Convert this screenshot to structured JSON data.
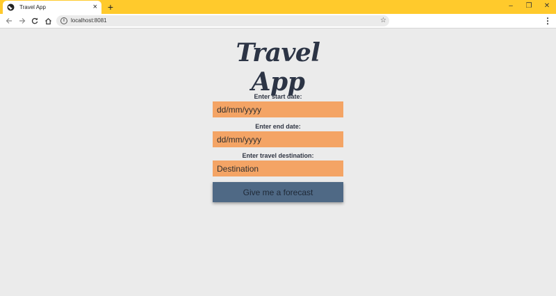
{
  "browser": {
    "tab_title": "Travel App",
    "tab_close": "×",
    "new_tab": "+",
    "url": "localhost:8081",
    "window_controls": {
      "minimize": "–",
      "restore": "❐",
      "close": "✕"
    }
  },
  "app": {
    "title": "Travel App",
    "form": {
      "start_date": {
        "label": "Enter start date:",
        "placeholder": "dd/mm/yyyy"
      },
      "end_date": {
        "label": "Enter end date:",
        "placeholder": "dd/mm/yyyy"
      },
      "destination": {
        "label": "Enter travel destination:",
        "placeholder": "Destination"
      },
      "submit_label": "Give me a forecast"
    }
  },
  "icons": [
    "globe-icon",
    "close-icon",
    "plus-icon",
    "back-arrow-icon",
    "forward-arrow-icon",
    "reload-icon",
    "home-icon",
    "info-icon",
    "star-icon",
    "menu-dots-icon"
  ],
  "colors": {
    "tab_strip": "#ffca2c",
    "page_background": "#ebebeb",
    "input_background": "#f4a465",
    "button_background": "#4f6985",
    "title_text": "#2c3445"
  }
}
